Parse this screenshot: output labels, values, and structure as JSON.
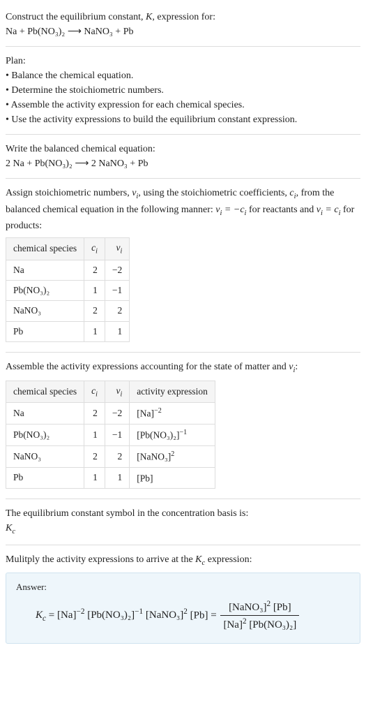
{
  "intro": {
    "line1_a": "Construct the equilibrium constant, ",
    "line1_b": ", expression for:",
    "equation": "Na + Pb(NO₃)₂  ⟶  NaNO₃ + Pb"
  },
  "plan": {
    "heading": "Plan:",
    "b1": "Balance the chemical equation.",
    "b2": "Determine the stoichiometric numbers.",
    "b3": "Assemble the activity expression for each chemical species.",
    "b4": "Use the activity expressions to build the equilibrium constant expression."
  },
  "balanced": {
    "heading": "Write the balanced chemical equation:",
    "equation": "2 Na + Pb(NO₃)₂  ⟶  2 NaNO₃ + Pb"
  },
  "stoich": {
    "text_a": "Assign stoichiometric numbers, ",
    "text_b": ", using the stoichiometric coefficients, ",
    "text_c": ", from the balanced chemical equation in the following manner: ",
    "text_d": " for reactants and ",
    "text_e": " for products:",
    "nu_i": "νᵢ",
    "c_i": "cᵢ",
    "table1": {
      "h1": "chemical species",
      "h2": "cᵢ",
      "h3": "νᵢ",
      "rows": [
        {
          "sp": "Na",
          "c": "2",
          "v": "−2"
        },
        {
          "sp": "Pb(NO₃)₂",
          "c": "1",
          "v": "−1"
        },
        {
          "sp": "NaNO₃",
          "c": "2",
          "v": "2"
        },
        {
          "sp": "Pb",
          "c": "1",
          "v": "1"
        }
      ]
    }
  },
  "activity": {
    "heading_a": "Assemble the activity expressions accounting for the state of matter and ",
    "heading_b": ":",
    "table2": {
      "h1": "chemical species",
      "h2": "cᵢ",
      "h3": "νᵢ",
      "h4": "activity expression",
      "rows": [
        {
          "sp": "Na",
          "c": "2",
          "v": "−2",
          "ae_base": "[Na]",
          "ae_exp": "−2"
        },
        {
          "sp": "Pb(NO₃)₂",
          "c": "1",
          "v": "−1",
          "ae_base": "[Pb(NO₃)₂]",
          "ae_exp": "−1"
        },
        {
          "sp": "NaNO₃",
          "c": "2",
          "v": "2",
          "ae_base": "[NaNO₃]",
          "ae_exp": "2"
        },
        {
          "sp": "Pb",
          "c": "1",
          "v": "1",
          "ae_base": "[Pb]",
          "ae_exp": ""
        }
      ]
    }
  },
  "basis": {
    "line": "The equilibrium constant symbol in the concentration basis is:",
    "symbol": "K",
    "symbol_sub": "c"
  },
  "multiply": {
    "line_a": "Mulitply the activity expressions to arrive at the ",
    "line_b": " expression:"
  },
  "answer": {
    "label": "Answer:",
    "lhs_a": "K",
    "lhs_b": "c",
    "eq": " = ",
    "t1_base": "[Na]",
    "t1_exp": "−2",
    "t2_base": "[Pb(NO₃)₂]",
    "t2_exp": "−1",
    "t3_base": "[NaNO₃]",
    "t3_exp": "2",
    "t4_base": "[Pb]",
    "frac_num_a": "[NaNO₃]",
    "frac_num_a_exp": "2",
    "frac_num_b": " [Pb]",
    "frac_den_a": "[Na]",
    "frac_den_a_exp": "2",
    "frac_den_b": " [Pb(NO₃)₂]"
  }
}
